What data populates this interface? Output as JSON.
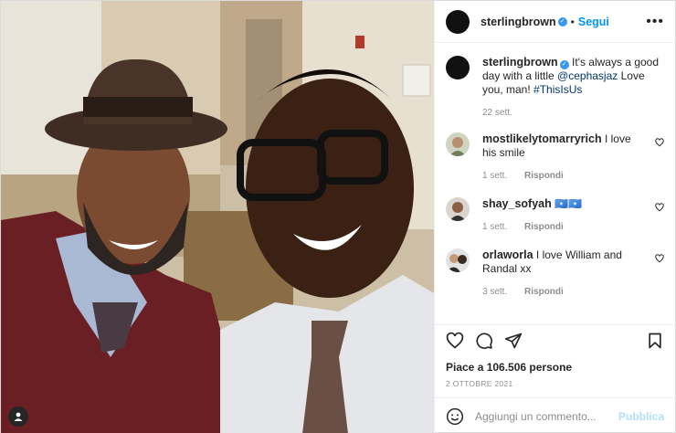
{
  "post": {
    "username": "sterlingbrown",
    "follow_label": "Segui",
    "more_label": "•••"
  },
  "caption": {
    "username": "sterlingbrown",
    "text_before": "It's always a good day with a little ",
    "mention": "@cephasjaz",
    "text_after": " Love you, man! ",
    "hashtag": "#ThisIsUs",
    "time": "22 sett."
  },
  "comments": [
    {
      "username": "mostlikelytomarryrich",
      "text": "I love his smile",
      "time": "1 sett.",
      "reply": "Rispondi"
    },
    {
      "username": "shay_sofyah",
      "text": "🇸🇴🇸🇴",
      "time": "1 sett.",
      "reply": "Rispondi"
    },
    {
      "username": "orlaworla",
      "text": "I love William and Randal xx",
      "time": "3 sett.",
      "reply": "Rispondi"
    }
  ],
  "likes_text": "Piace a 106.506 persone",
  "date_text": "2 OTTOBRE 2021",
  "composer": {
    "placeholder": "Aggiungi un commento...",
    "publish_label": "Pubblica"
  },
  "icons": {
    "like": "heart-icon",
    "comment": "comment-bubble-icon",
    "share": "paper-plane-icon",
    "save": "bookmark-icon",
    "emoji": "smiley-icon",
    "tag": "user-tag-icon",
    "verified": "verified-badge-icon"
  },
  "colors": {
    "link": "#00376b",
    "follow": "#0095f6",
    "verified": "#3897f0",
    "publish_disabled": "#b2dffc",
    "muted": "#8e8e8e"
  }
}
